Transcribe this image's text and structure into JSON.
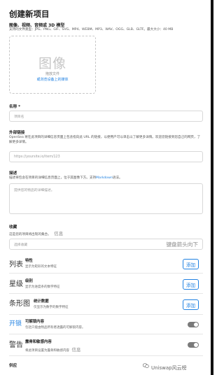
{
  "page": {
    "title": "创建新项目",
    "media_title": "图像、视频、音频或 3D 模型",
    "supported_types": "支持的文件类型：JPG、PNG、GIF、SVG、MP4、WEBM、MP3、WAV、OGG、GLB、GLTF。最大大小：40 MB"
  },
  "upload": {
    "placeholder_big": "图像",
    "line1": "拖放文件",
    "line2": "或浏览设备上的媒体"
  },
  "name": {
    "label": "名称 *",
    "placeholder": "项目名"
  },
  "external_link": {
    "label": "外部链接",
    "desc": "OpenSea 将在此项目的详细信息页面上包含指向此 URL 的链接，以便用户可以单击以了解更多详情。欢迎您链接到您自己的网页，了解更多详情。",
    "placeholder": "https://yoursite.io/item/123"
  },
  "description": {
    "label": "描述",
    "desc_prefix": "描述将包含在项目的详细信息页面上，位于其图像下方。支持",
    "desc_link": "Markdown",
    "desc_suffix": "语法。",
    "placeholder": "提供您的物品的详细描述。"
  },
  "collection": {
    "label": "收藏",
    "desc": "这是您的项目将出现的集合。",
    "desc_overlay": "信息",
    "placeholder": "选择收藏",
    "overlay_right": "键盘箭头向下"
  },
  "rows": [
    {
      "big": "列表",
      "label": "特性",
      "desc": "显示为矩形的文本特征",
      "action": "添加"
    },
    {
      "big": "星级",
      "label": "级别",
      "desc": "显示为进度条的数字特征",
      "action": "添加"
    },
    {
      "big": "条形图",
      "label": "统计数据",
      "desc": "仅显示为数字的数字特征",
      "action": "添加"
    }
  ],
  "toggles": [
    {
      "big": "开锁",
      "label": "可解锁内容",
      "desc": "包括只能由物品所有者透露的可解锁内容。"
    },
    {
      "big": "警告",
      "label": "露骨和敏感内容",
      "desc": "将此项目设置为露骨和敏感内容",
      "extra": "信息"
    }
  ],
  "supply": {
    "label": "供应"
  },
  "watermark": {
    "text": "Uniswap风云榜"
  },
  "colors": {
    "accent": "#2081e2",
    "toggle": "#7a7a7a"
  }
}
